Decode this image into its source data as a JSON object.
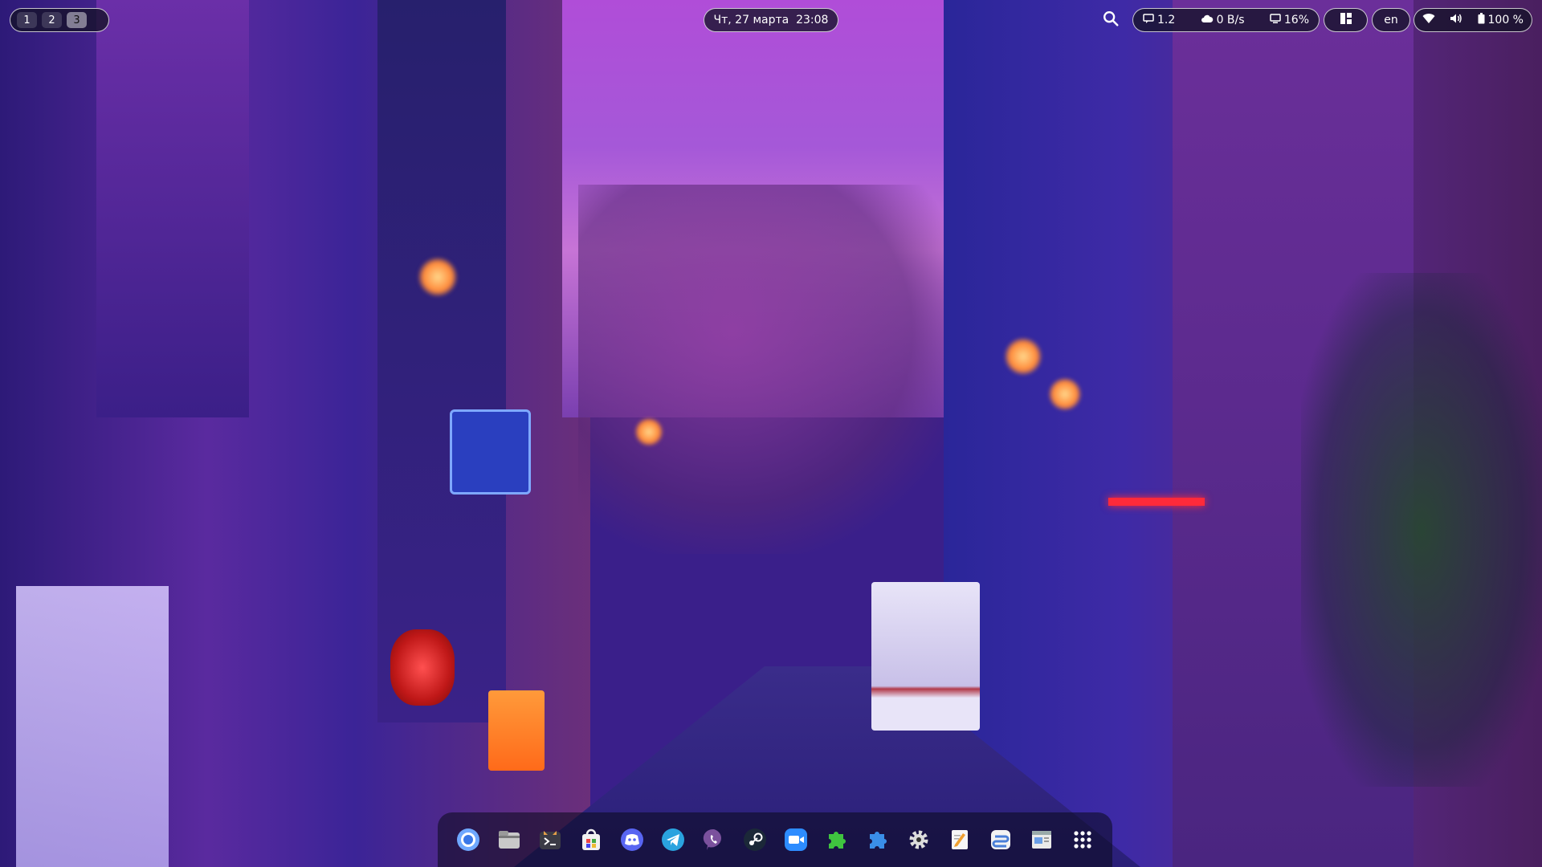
{
  "topbar": {
    "workspaces": [
      {
        "label": "1",
        "active": false
      },
      {
        "label": "2",
        "active": false
      },
      {
        "label": "3",
        "active": true
      }
    ],
    "clock": "Чт, 27 марта  23:08",
    "stats": {
      "notifications_count": "1.2",
      "network_speed": "0 B/s",
      "cpu_usage": "16%"
    },
    "language": "en",
    "battery": "100 %"
  },
  "dock": {
    "apps": [
      {
        "name": "chromium-icon"
      },
      {
        "name": "files-icon"
      },
      {
        "name": "terminal-icon"
      },
      {
        "name": "software-store-icon"
      },
      {
        "name": "discord-icon"
      },
      {
        "name": "telegram-icon"
      },
      {
        "name": "viber-icon"
      },
      {
        "name": "steam-icon"
      },
      {
        "name": "zoom-icon"
      },
      {
        "name": "extensions-icon"
      },
      {
        "name": "puzzle-icon"
      },
      {
        "name": "settings-icon"
      },
      {
        "name": "text-editor-icon"
      },
      {
        "name": "tweaks-icon"
      },
      {
        "name": "screenshot-icon"
      },
      {
        "name": "app-grid-icon"
      }
    ]
  },
  "colors": {
    "pill_bg": "#14122a",
    "pill_border": "#ffffff",
    "accent_sky": "#b04dd8"
  }
}
